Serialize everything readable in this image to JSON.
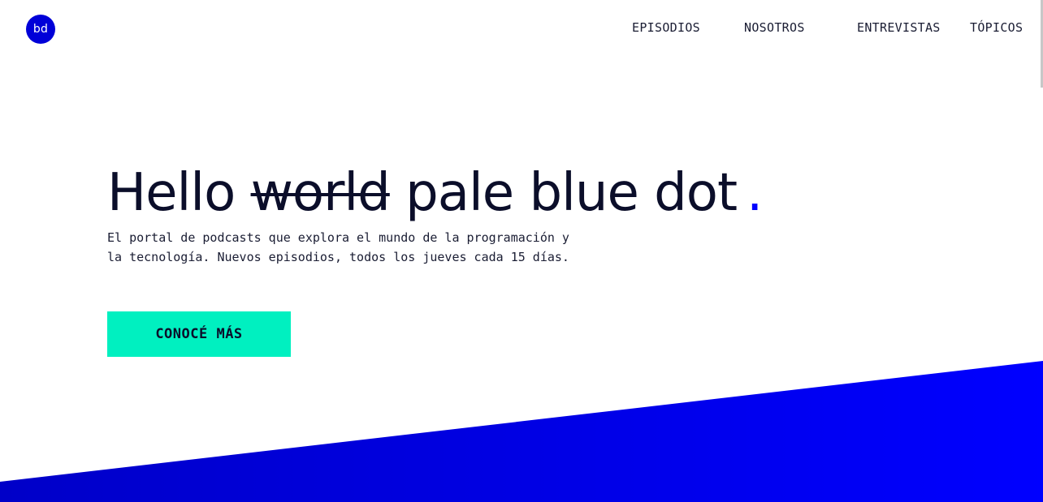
{
  "header": {
    "logo_text": "bd",
    "nav": [
      {
        "label": "EPISODIOS"
      },
      {
        "label": "NOSOTROS"
      },
      {
        "label": "ENTREVISTAS"
      },
      {
        "label": "TÓPICOS"
      }
    ]
  },
  "hero": {
    "title_before": "Hello",
    "title_struck": "world",
    "title_after": "pale blue dot",
    "title_dot": ".",
    "description_line1": "El portal de podcasts que explora el mundo de la programación y",
    "description_line2": "la tecnología. Nuevos episodios, todos los jueves cada 15 días.",
    "cta_label": "CONOCÉ MÁS"
  },
  "colors": {
    "brand_blue": "#0000d8",
    "accent_blue": "#0000ff",
    "cta_teal": "#00f0c0",
    "text_dark": "#0b0e2a"
  }
}
